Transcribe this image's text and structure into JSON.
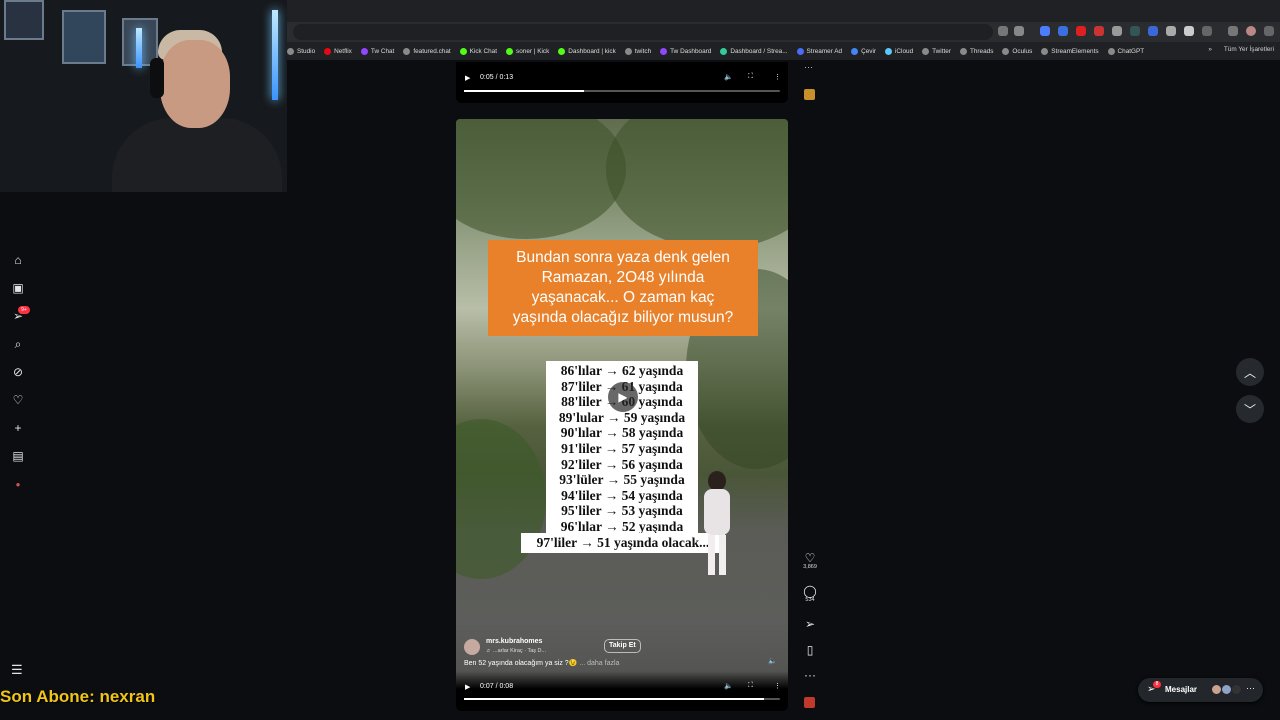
{
  "browser": {
    "bookmarks": [
      "Studio",
      "Netflix",
      "Tw Chat",
      "featured.chat",
      "Kick Chat",
      "soner | Kick",
      "Dashboard | kick",
      "twitch",
      "Tw Dashboard",
      "Dashboard / Strea...",
      "Streamer Ad",
      "Çevir",
      "iCloud",
      "Twitter",
      "Threads",
      "Oculus",
      "StreamElements",
      "ChatGPT"
    ],
    "bookmarks_more": "»",
    "all_bookmarks": "Tüm Yer İşaretleri"
  },
  "sidebar": {
    "notification_badge": "9+",
    "icons": [
      "home-icon",
      "reels-icon",
      "messages-icon",
      "search-icon",
      "explore-icon",
      "notifications-icon",
      "create-icon",
      "dashboard-icon",
      "profile-icon"
    ],
    "more": "☰"
  },
  "top_player": {
    "time": "0:05 / 0:13",
    "progress": 0.38
  },
  "reel": {
    "orange_text_lines": [
      "Bundan sonra yaza denk gelen",
      "Ramazan, 2O48 yılında",
      "yaşanacak... O zaman kaç",
      "yaşında olacağız biliyor musun?"
    ],
    "list_lines": [
      "86'lılar → 62 yaşında",
      "87'liler → 61 yaşında",
      "88'liler → 60 yaşında",
      "89'lular → 59 yaşında",
      "90'lılar → 58 yaşında",
      "91'liler → 57 yaşında",
      "92'liler → 56 yaşında",
      "93'lüler → 55 yaşında",
      "94'liler → 54 yaşında",
      "95'liler → 53 yaşında",
      "96'lılar → 52 yaşında"
    ],
    "last_line": "97'liler → 51 yaşında olacak...",
    "username": "mrs.kubrahomes",
    "audio": "♬ ...arlar    Kiraç · Taş D...",
    "follow_label": "Takip Et",
    "caption": "Ben 52 yaşında olacağım ya siz ?😉",
    "more_label": "... daha fazla",
    "time": "0:07 / 0:08",
    "progress": 0.95
  },
  "actions": {
    "likes": "3,869",
    "comments": "534"
  },
  "messages": {
    "label": "Mesajlar",
    "badge": "8"
  },
  "stream_overlay": {
    "text": "Son Abone: nexran"
  },
  "colors": {
    "background": "#0b0d10",
    "overlay_accent": "#f0c419",
    "badge": "#ff3040",
    "orange_card": "#e8812a"
  }
}
